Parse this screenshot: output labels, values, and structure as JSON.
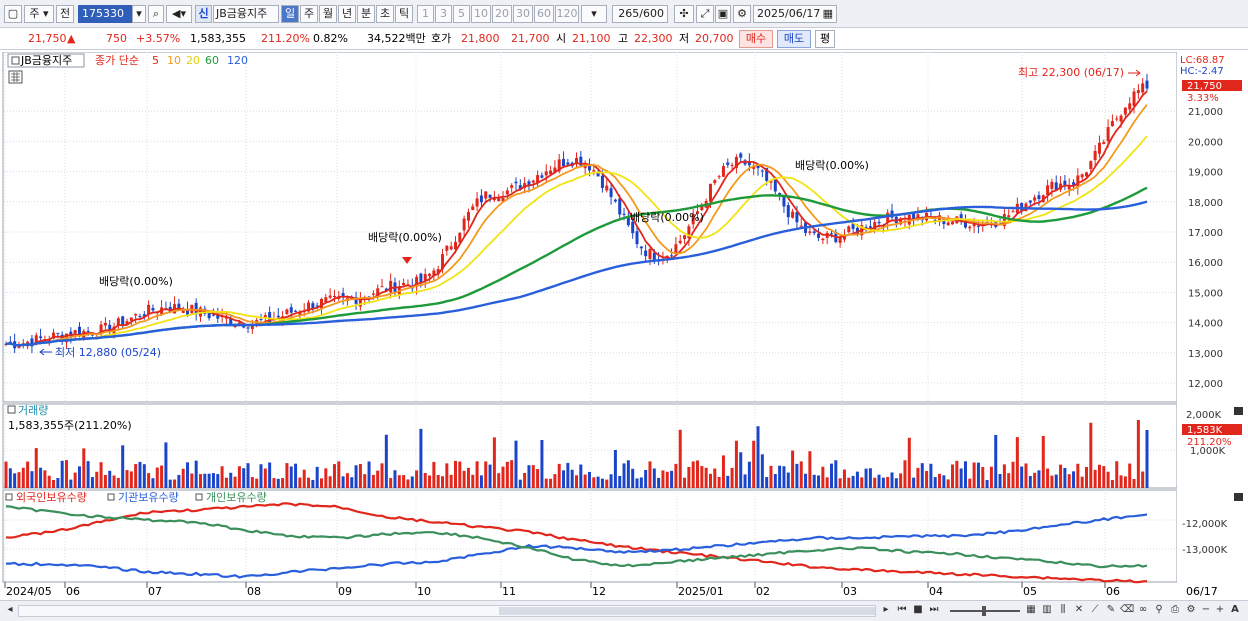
{
  "toolbar": {
    "market": "주",
    "prev": "전",
    "code": "175330",
    "stock_name": "JB금융지주",
    "periods": [
      "일",
      "주",
      "월",
      "년",
      "분",
      "초",
      "틱"
    ],
    "active_period": "일",
    "intervals": [
      "1",
      "3",
      "5",
      "10",
      "20",
      "30",
      "60",
      "120"
    ],
    "count": "265",
    "count_max": "/600",
    "date": "2025/06/17",
    "badge": "신"
  },
  "quote": {
    "price": "21,750",
    "arrow": "▲",
    "change": "750",
    "change_pct": "+3.57%",
    "volume": "1,583,355",
    "vol_ratio": "211.20%",
    "turnover": "0.82%",
    "amount": "34,522백만",
    "ask_label": "호가",
    "ask": "21,800",
    "bid": "21,700",
    "open_label": "시",
    "open": "21,100",
    "high_label": "고",
    "high": "22,300",
    "low_label": "저",
    "low": "20,700",
    "buy_label": "매수",
    "sell_label": "매도",
    "avg_label": "평"
  },
  "price_panel": {
    "stock_label": "JB금융지주",
    "ma_title": "종가 단순",
    "ma_periods": [
      "5",
      "10",
      "20",
      "60",
      "120"
    ],
    "ma_colors": [
      "#e1261c",
      "#f39a1e",
      "#f2e312",
      "#1f9a3a",
      "#2a5fdc"
    ],
    "lc_label": "LC:68.87",
    "hc_label": "HC:-2.47",
    "current_tag": "21,750",
    "current_pct": "3.33%",
    "y_ticks": [
      "21,000",
      "20,000",
      "19,000",
      "18,000",
      "17,000",
      "16,000",
      "15,000",
      "14,000",
      "13,000",
      "12,000"
    ],
    "high_note": "최고 22,300 (06/17)",
    "low_note": "최저 12,880 (05/24)",
    "dividend_notes": [
      "배당락(0.00%)",
      "배당락(0.00%)",
      "배당락(0.00%)",
      "배당락(0.00%)"
    ]
  },
  "volume_panel": {
    "title": "거래량",
    "value": "1,583,355주(211.20%)",
    "y_ticks": [
      "2,000K",
      "1,000K"
    ],
    "current_tag": "1,583K",
    "current_pct": "211.20%"
  },
  "holding_panel": {
    "legend": [
      "외국인보유수량",
      "기관보유수량",
      "개인보유수량"
    ],
    "legend_colors": [
      "#e1261c",
      "#2a5fdc",
      "#3a8f5a"
    ],
    "y_ticks": [
      "-12,000K",
      "-13,000K"
    ]
  },
  "x_axis": {
    "labels": [
      "2024/05",
      "06",
      "07",
      "08",
      "09",
      "10",
      "11",
      "12",
      "2025/01",
      "02",
      "03",
      "04",
      "05",
      "06"
    ],
    "end_label": "06/17"
  },
  "chart_data": {
    "type": "line",
    "title": "",
    "xlabel": "",
    "ylabel": "",
    "ylim": [
      11500,
      22500
    ],
    "x": [
      "2024/05",
      "06",
      "07",
      "08",
      "09",
      "10",
      "11",
      "12",
      "2025/01",
      "02",
      "03",
      "04",
      "05",
      "06",
      "06/17"
    ],
    "series": [
      {
        "values": [
          13300,
          13700,
          14500,
          14000,
          14700,
          15300,
          18300,
          19400,
          16200,
          19300,
          16800,
          17500,
          17300,
          18600,
          21750
        ]
      }
    ]
  }
}
